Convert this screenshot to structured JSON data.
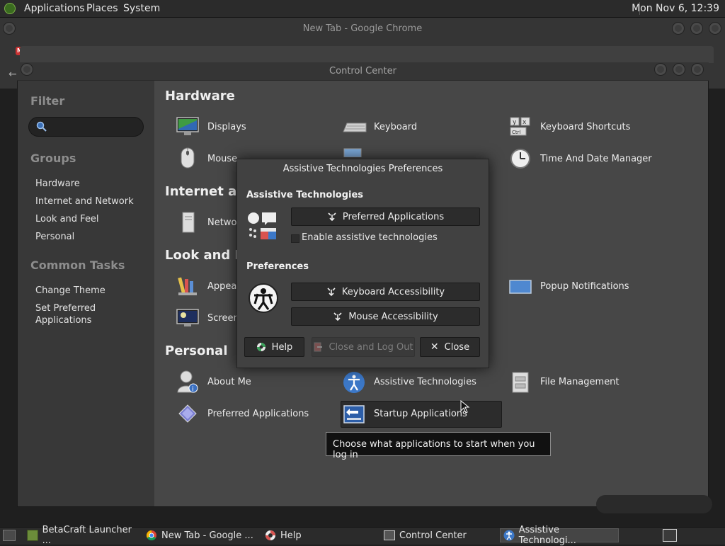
{
  "top_panel": {
    "menus": [
      "Applications",
      "Places",
      "System"
    ],
    "clock": "Mon Nov 6, 12:39"
  },
  "chrome": {
    "title": "New Tab - Google Chrome"
  },
  "control_center": {
    "title": "Control Center",
    "sidebar": {
      "filter_label": "Filter",
      "groups_label": "Groups",
      "groups": [
        "Hardware",
        "Internet and Network",
        "Look and Feel",
        "Personal"
      ],
      "common_tasks_label": "Common Tasks",
      "tasks": [
        "Change Theme",
        "Set Preferred\nApplications"
      ]
    },
    "sections": {
      "hardware": "Hardware",
      "internet": "Internet and",
      "look": "Look and Fe",
      "personal": "Personal"
    },
    "items": {
      "displays": "Displays",
      "keyboard": "Keyboard",
      "keyboard_shortcuts": "Keyboard Shortcuts",
      "mouse": "Mouse",
      "time_date": "Time And Date Manager",
      "network": "Netwo",
      "appearance": "Appea",
      "popup": "Popup Notifications",
      "screensaver": "Screen",
      "about_me": "About Me",
      "assistive": "Assistive Technologies",
      "file_mgmt": "File Management",
      "preferred_apps": "Preferred Applications",
      "startup_apps": "Startup Applications"
    },
    "tooltip": "Choose what applications to start when you log in"
  },
  "dialog": {
    "title": "Assistive Technologies Preferences",
    "section1": "Assistive Technologies",
    "preferred_btn": "Preferred Applications",
    "enable_label": "Enable assistive technologies",
    "section2": "Preferences",
    "keyboard_btn": "Keyboard Accessibility",
    "mouse_btn": "Mouse Accessibility",
    "help_btn": "Help",
    "logout_btn": "Close and Log Out",
    "close_btn": "Close"
  },
  "taskbar": {
    "items": [
      "BetaCraft Launcher ...",
      "New Tab - Google ...",
      "Help",
      "Control Center",
      "Assistive Technologi..."
    ]
  }
}
